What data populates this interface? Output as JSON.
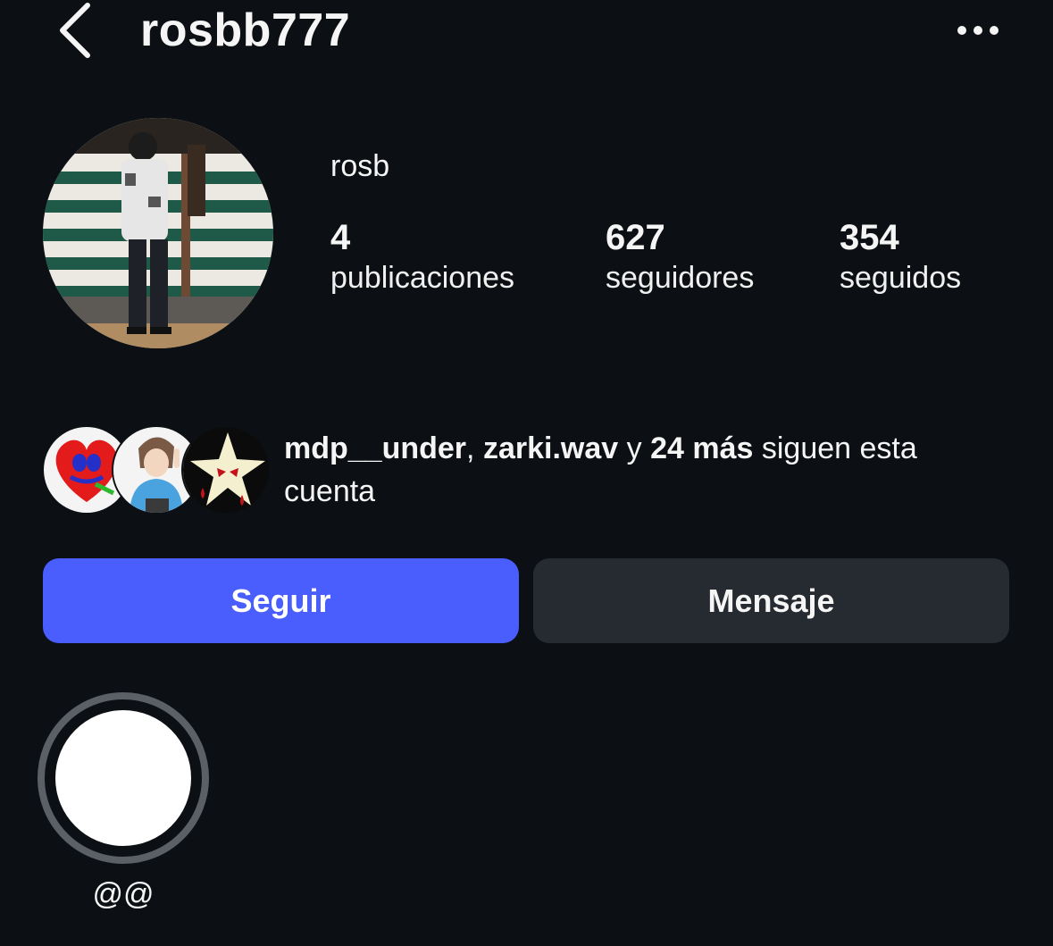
{
  "header": {
    "username": "rosbb777",
    "back_icon": "chevron-left-icon",
    "more_icon": "more-horizontal-icon"
  },
  "profile": {
    "display_name": "rosb",
    "stats": [
      {
        "value": "4",
        "label": "publicaciones"
      },
      {
        "value": "627",
        "label": "seguidores"
      },
      {
        "value": "354",
        "label": "seguidos"
      }
    ]
  },
  "followed_by": {
    "user1": "mdp__under",
    "separator": ", ",
    "user2": "zarki.wav",
    "conjunction": " y ",
    "more": "24 más",
    "suffix": " siguen esta cuenta"
  },
  "actions": {
    "follow_label": "Seguir",
    "message_label": "Mensaje"
  },
  "highlights": [
    {
      "label": "@@"
    }
  ],
  "colors": {
    "background": "#0c1014",
    "follow_button": "#4a5dfd",
    "message_button": "#262a31",
    "highlight_ring": "#5b5f66"
  }
}
